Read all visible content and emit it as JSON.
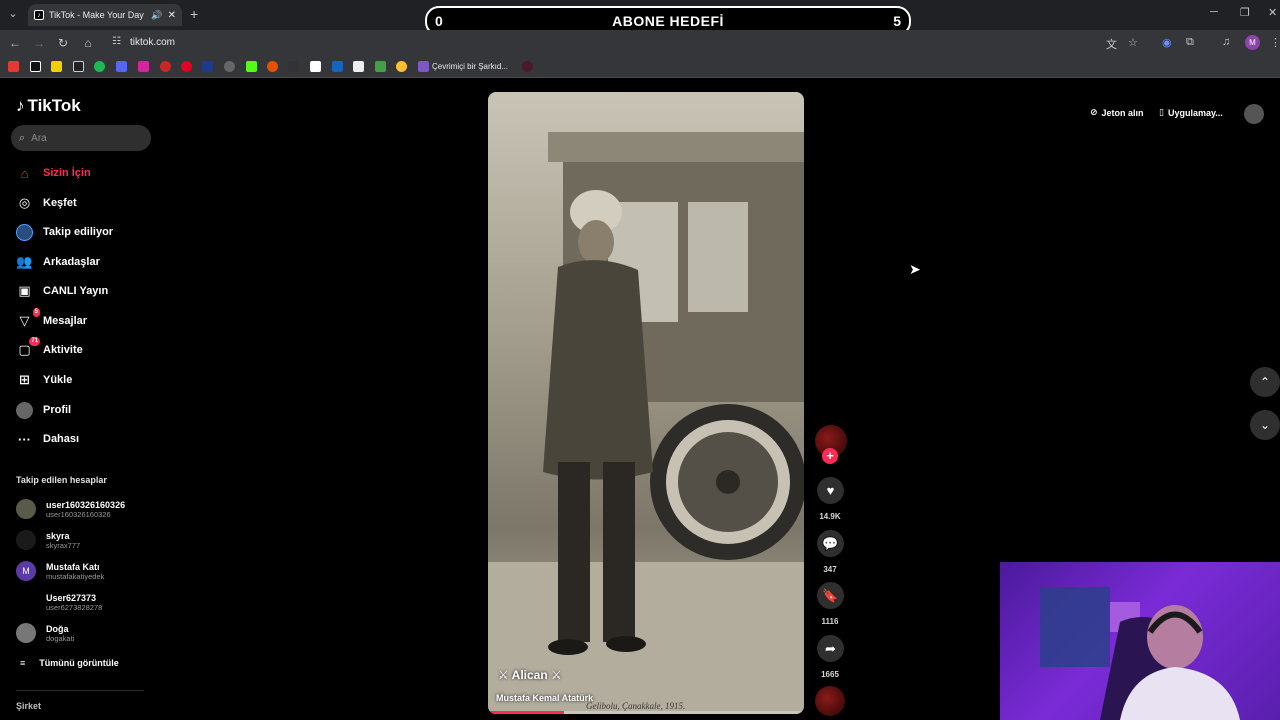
{
  "browser": {
    "tab_title": "TikTok - Make Your Day",
    "url": "tiktok.com",
    "bookmark_label": "Çevrimiçi bir Şarkıd..."
  },
  "overlay": {
    "goal_title": "ABONE HEDEFİ",
    "goal_current": "0",
    "goal_target": "5"
  },
  "tiktok": {
    "logo": "TikTok",
    "search_placeholder": "Ara",
    "nav": [
      {
        "label": "Sizin İçin",
        "icon": "home-icon"
      },
      {
        "label": "Keşfet",
        "icon": "compass-icon"
      },
      {
        "label": "Takip ediliyor",
        "icon": "following-icon"
      },
      {
        "label": "Arkadaşlar",
        "icon": "friends-icon"
      },
      {
        "label": "CANLI Yayın",
        "icon": "live-icon"
      },
      {
        "label": "Mesajlar",
        "icon": "messages-icon",
        "badge": "5"
      },
      {
        "label": "Aktivite",
        "icon": "activity-icon",
        "badge": "71"
      },
      {
        "label": "Yükle",
        "icon": "upload-icon"
      },
      {
        "label": "Profil",
        "icon": "profile-icon"
      },
      {
        "label": "Dahası",
        "icon": "more-icon"
      }
    ],
    "following_title": "Takip edilen hesaplar",
    "accounts": [
      {
        "name": "user160326160326",
        "handle": "user160326160326"
      },
      {
        "name": "skyra",
        "handle": "skyrax777"
      },
      {
        "name": "Mustafa Katı",
        "handle": "mustafakatiyedek",
        "initial": "M"
      },
      {
        "name": "User627373",
        "handle": "user6273828278"
      },
      {
        "name": "Doğa",
        "handle": "dogakati"
      }
    ],
    "see_all": "Tümünü görüntüle",
    "company": "Şirket",
    "coins": "Jeton alın",
    "get_app": "Uygulamay..."
  },
  "video": {
    "author": "Alican",
    "description": "Mustafa Kemal Atatürk",
    "caption": "Gelibolu, Çanakkale, 1915.",
    "progress": 0.24
  },
  "actions": {
    "likes": "14.9K",
    "comments": "347",
    "saves": "1116",
    "shares": "1665"
  },
  "colors": {
    "accent": "#fe2c55",
    "background": "#000000"
  }
}
